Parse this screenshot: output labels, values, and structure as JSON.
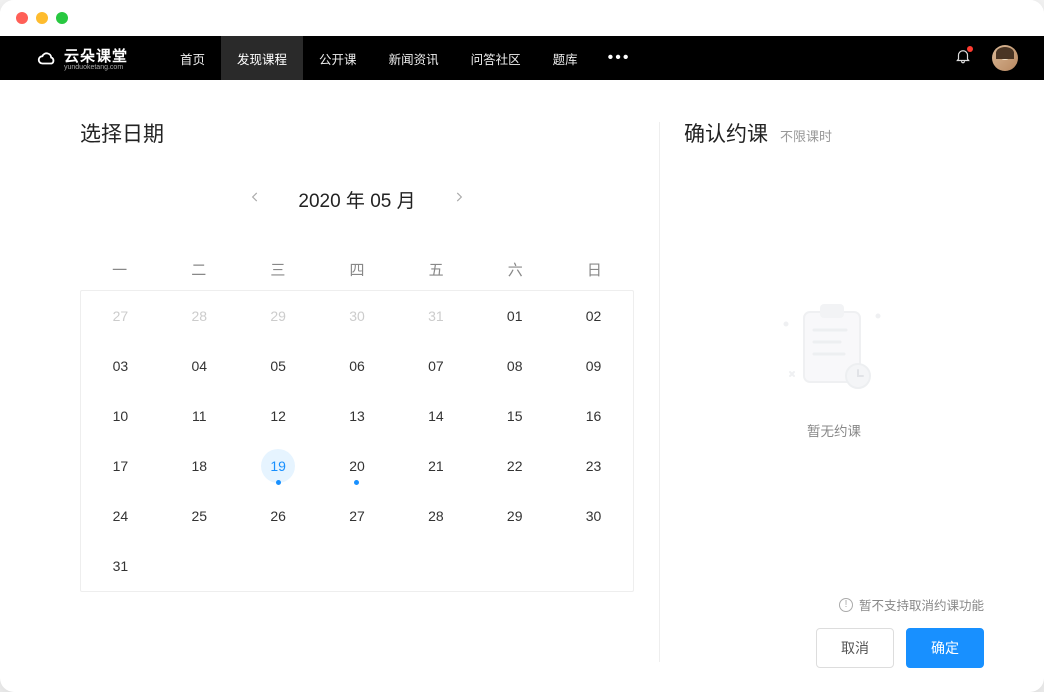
{
  "nav": {
    "brand_main": "云朵课堂",
    "brand_sub": "yunduoketang.com",
    "items": [
      "首页",
      "发现课程",
      "公开课",
      "新闻资讯",
      "问答社区",
      "题库"
    ],
    "active_index": 1,
    "has_notification": true
  },
  "calendar": {
    "title": "选择日期",
    "header": "2020 年 05 月",
    "weekdays": [
      "一",
      "二",
      "三",
      "四",
      "五",
      "六",
      "日"
    ],
    "selected_day": 19,
    "marked_days": [
      19,
      20
    ],
    "cells": [
      {
        "n": "27",
        "other": true
      },
      {
        "n": "28",
        "other": true
      },
      {
        "n": "29",
        "other": true
      },
      {
        "n": "30",
        "other": true
      },
      {
        "n": "31",
        "other": true
      },
      {
        "n": "01"
      },
      {
        "n": "02"
      },
      {
        "n": "03"
      },
      {
        "n": "04"
      },
      {
        "n": "05"
      },
      {
        "n": "06"
      },
      {
        "n": "07"
      },
      {
        "n": "08"
      },
      {
        "n": "09"
      },
      {
        "n": "10"
      },
      {
        "n": "11"
      },
      {
        "n": "12"
      },
      {
        "n": "13"
      },
      {
        "n": "14"
      },
      {
        "n": "15"
      },
      {
        "n": "16"
      },
      {
        "n": "17"
      },
      {
        "n": "18"
      },
      {
        "n": "19"
      },
      {
        "n": "20"
      },
      {
        "n": "21"
      },
      {
        "n": "22"
      },
      {
        "n": "23"
      },
      {
        "n": "24"
      },
      {
        "n": "25"
      },
      {
        "n": "26"
      },
      {
        "n": "27"
      },
      {
        "n": "28"
      },
      {
        "n": "29"
      },
      {
        "n": "30"
      },
      {
        "n": "31"
      }
    ]
  },
  "confirm": {
    "title": "确认约课",
    "subtitle": "不限课时",
    "empty_text": "暂无约课",
    "notice": "暂不支持取消约课功能",
    "cancel_label": "取消",
    "ok_label": "确定"
  }
}
